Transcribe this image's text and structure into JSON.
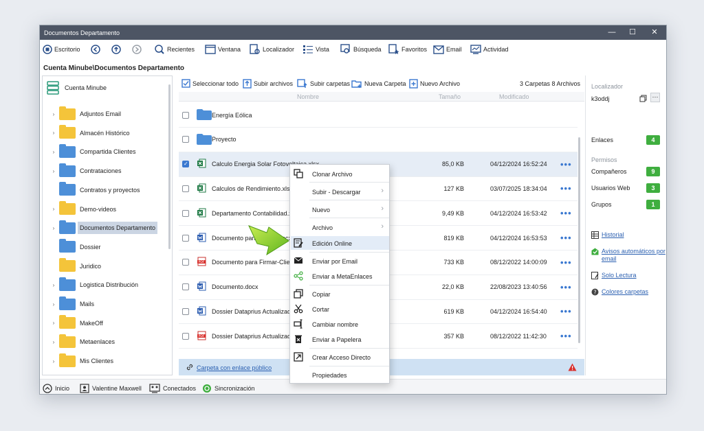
{
  "window": {
    "title": "Documentos Departamento",
    "minimize": "—",
    "maximize": "☐",
    "close": "✕"
  },
  "toolbar": {
    "escritorio": "Escritorio",
    "recientes": "Recientes",
    "ventana": "Ventana",
    "localizador": "Localizador",
    "vista": "Vista",
    "busqueda": "Búsqueda",
    "favoritos": "Favoritos",
    "email": "Email",
    "actividad": "Actividad"
  },
  "path": "Cuenta Minube\\Documentos Departamento",
  "tree": {
    "root": "Cuenta Minube",
    "items": [
      {
        "label": "Adjuntos Email",
        "color": "yellow",
        "twisty": "›"
      },
      {
        "label": "Almacén Histórico",
        "color": "yellow",
        "twisty": "›"
      },
      {
        "label": "Compartida Clientes",
        "color": "blue",
        "twisty": "›"
      },
      {
        "label": "Contrataciones",
        "color": "blue",
        "twisty": "›"
      },
      {
        "label": "Contratos y proyectos",
        "color": "blue",
        "twisty": ""
      },
      {
        "label": "Demo-videos",
        "color": "yellow",
        "twisty": "›"
      },
      {
        "label": "Documentos Departamento",
        "color": "blue",
        "twisty": "›",
        "selected": true
      },
      {
        "label": "Dossier",
        "color": "blue",
        "twisty": ""
      },
      {
        "label": "Juridico",
        "color": "yellow",
        "twisty": ""
      },
      {
        "label": "Logistica Distribución",
        "color": "blue",
        "twisty": "›"
      },
      {
        "label": "Mails",
        "color": "blue",
        "twisty": "›"
      },
      {
        "label": "MakeOff",
        "color": "yellow",
        "twisty": "›"
      },
      {
        "label": "Metaenlaces",
        "color": "yellow",
        "twisty": "›"
      },
      {
        "label": "Mis Clientes",
        "color": "yellow",
        "twisty": "›"
      }
    ]
  },
  "filetoolbar": {
    "select_all": "Seleccionar todo",
    "upload_files": "Subir archivos",
    "upload_folders": "Subir carpetas",
    "new_folder": "Nueva Carpeta",
    "new_file": "Nuevo Archivo",
    "counts": "3 Carpetas  8 Archivos"
  },
  "columns": {
    "name": "Nombre",
    "size": "Tamaño",
    "modified": "Modificado"
  },
  "files": [
    {
      "name": "Energía Eólica",
      "type": "folder",
      "size": "",
      "date": "",
      "checked": false
    },
    {
      "name": "Proyecto",
      "type": "folder",
      "size": "",
      "date": "",
      "checked": false
    },
    {
      "name": "Calculo Energia Solar Fotovoltaica.xlsx",
      "type": "xlsx",
      "size": "85,0 KB",
      "date": "04/12/2024 16:52:24",
      "checked": true
    },
    {
      "name": "Calculos de Rendimiento.xlsx",
      "type": "xlsx",
      "size": "127 KB",
      "date": "03/07/2025 18:34:04",
      "checked": false
    },
    {
      "name": "Departamento Contabilidad.xlsx",
      "type": "xlsx",
      "size": "9,49 KB",
      "date": "04/12/2024 16:53:42",
      "checked": false
    },
    {
      "name": "Documento para Firmar.docx",
      "type": "docx",
      "size": "819 KB",
      "date": "04/12/2024 16:53:53",
      "checked": false
    },
    {
      "name": "Documento para Firmar-Cliente.pdf",
      "type": "pdf",
      "size": "733 KB",
      "date": "08/12/2022 14:00:09",
      "checked": false
    },
    {
      "name": "Documento.docx",
      "type": "docx",
      "size": "22,0 KB",
      "date": "22/08/2023 13:40:56",
      "checked": false
    },
    {
      "name": "Dossier Dataprius Actualizado.docx",
      "type": "docx",
      "size": "619 KB",
      "date": "04/12/2024 16:54:40",
      "checked": false
    },
    {
      "name": "Dossier Dataprius Actualizado.pdf",
      "type": "pdf",
      "size": "357 KB",
      "date": "08/12/2022 11:42:30",
      "checked": false
    }
  ],
  "more_dots": "•••",
  "public_link": "Carpeta con enlace público",
  "right": {
    "localizador_title": "Localizador",
    "localizador_value": "k3oddj",
    "enlaces": "Enlaces",
    "enlaces_count": "4",
    "permisos_title": "Permisos",
    "companeros": "Compañeros",
    "companeros_count": "9",
    "usuarios_web": "Usuarios Web",
    "usuarios_web_count": "3",
    "grupos": "Grupos",
    "grupos_count": "1",
    "historial": "Historial",
    "avisos": "Avisos automáticos por email",
    "solo_lectura": "Solo Lectura",
    "colores": "Colores carpetas"
  },
  "status": {
    "inicio": "Inicio",
    "user": "Valentine Maxwell",
    "conectados": "Conectados",
    "sync": "Sincronización"
  },
  "context_menu": {
    "clonar": "Clonar Archivo",
    "subir_descargar": "Subir - Descargar",
    "nuevo": "Nuevo",
    "archivo": "Archivo",
    "edicion_online": "Edición Online",
    "enviar_email": "Enviar por Email",
    "enviar_meta": "Enviar a MetaEnlaces",
    "copiar": "Copiar",
    "cortar": "Cortar",
    "cambiar_nombre": "Cambiar nombre",
    "enviar_papelera": "Enviar a Papelera",
    "crear_acceso": "Crear Acceso Directo",
    "propiedades": "Propiedades"
  },
  "colors": {
    "accent": "#3a78d0",
    "badge": "#3fae3f",
    "folder_yellow": "#f4c43a",
    "folder_blue": "#4d8fd8",
    "titlebar": "#4d5564"
  }
}
